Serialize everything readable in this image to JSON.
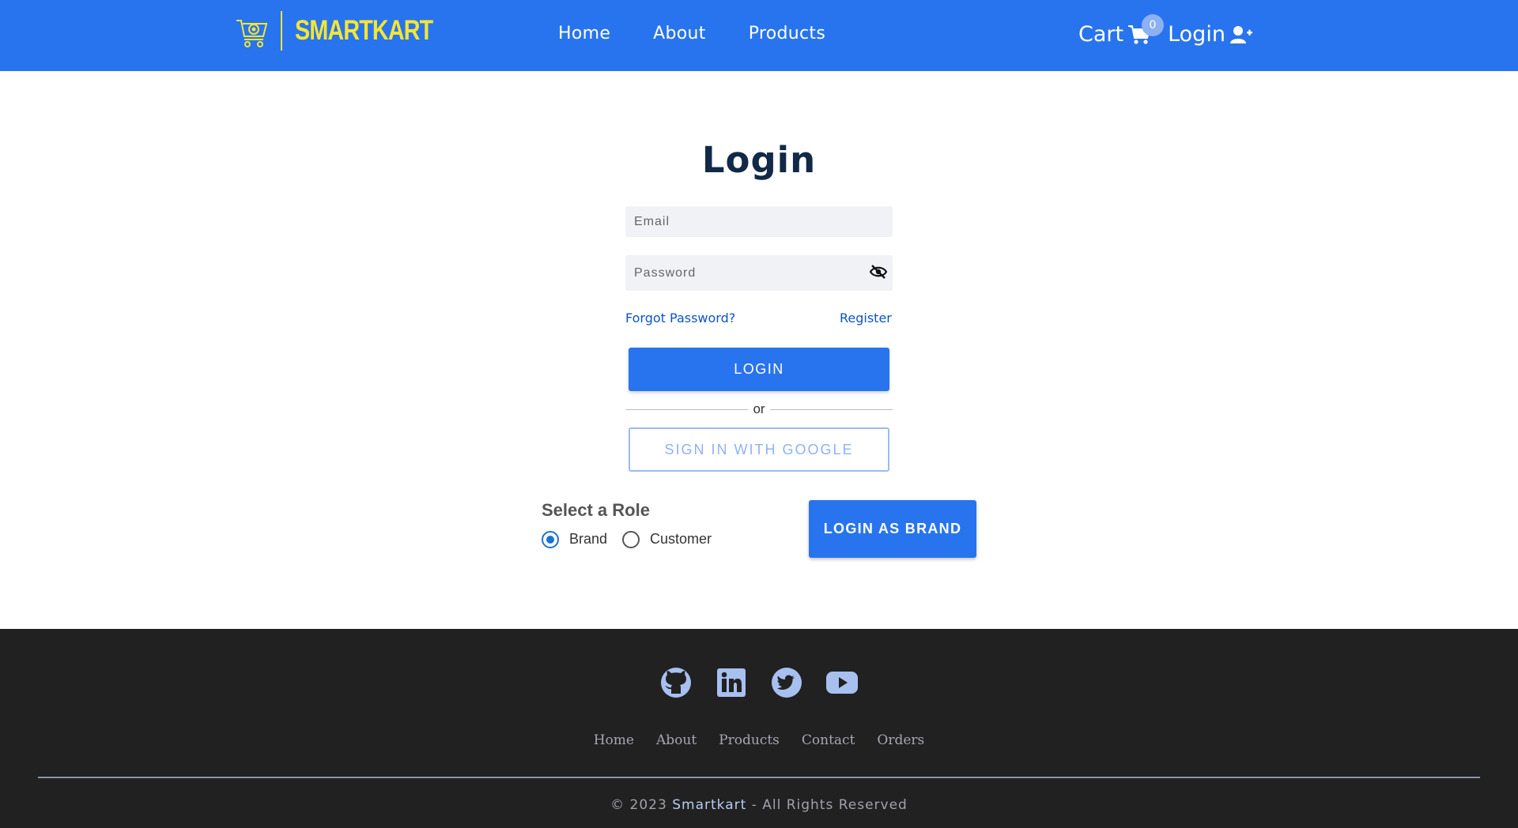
{
  "navbar": {
    "logo_text": "SMARTKART",
    "links": [
      "Home",
      "About",
      "Products"
    ],
    "cart_label": "Cart",
    "cart_count": "0",
    "login_label": "Login"
  },
  "login_form": {
    "title": "Login",
    "email_placeholder": "Email",
    "password_placeholder": "Password",
    "forgot_password": "Forgot Password?",
    "register": "Register",
    "login_button": "LOGIN",
    "divider_text": "or",
    "google_button": "SIGN IN WITH GOOGLE"
  },
  "role": {
    "title": "Select a Role",
    "options": [
      "Brand",
      "Customer"
    ],
    "selected": "Brand",
    "login_as_button": "LOGIN AS BRAND"
  },
  "footer": {
    "social_icons": [
      "github-icon",
      "linkedin-icon",
      "twitter-icon",
      "youtube-icon"
    ],
    "links": [
      "Home",
      "About",
      "Products",
      "Contact",
      "Orders"
    ],
    "copyright_prefix": "© 2023",
    "copyright_brand": "Smartkart",
    "copyright_suffix": "- All Rights Reserved"
  },
  "colors": {
    "primary": "#2874ee",
    "logo_yellow": "#f5e633",
    "footer_bg": "#212121",
    "title_text": "#102a47",
    "link_blue": "#0b54c9"
  }
}
